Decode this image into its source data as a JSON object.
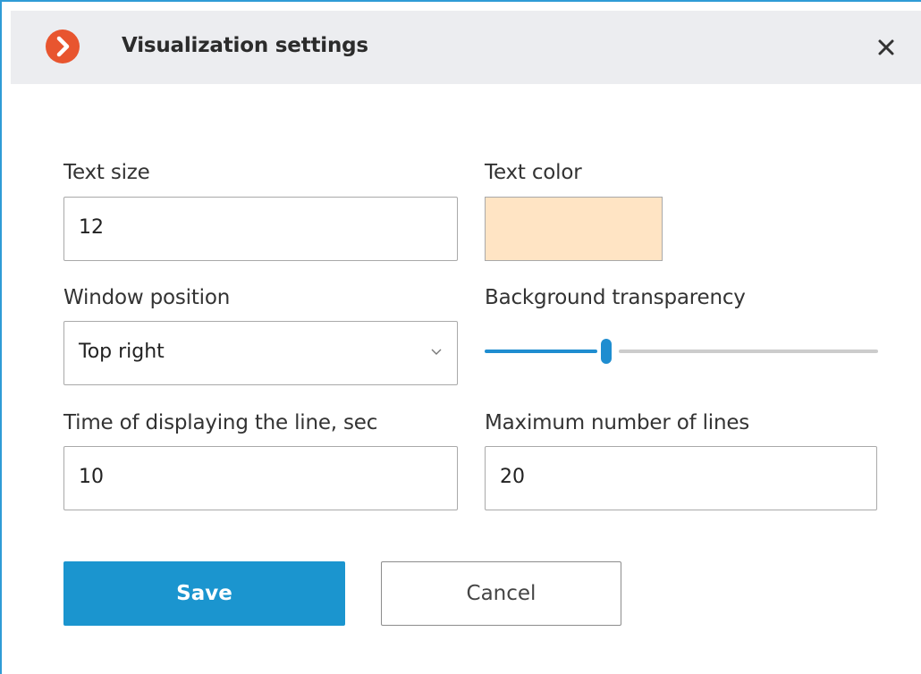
{
  "dialog": {
    "title": "Visualization settings",
    "app_icon": "chevron-right-circle-icon",
    "close_icon": "close-icon"
  },
  "fields": {
    "text_size": {
      "label": "Text size",
      "value": "12"
    },
    "text_color": {
      "label": "Text color",
      "color": "#ffe4c4"
    },
    "window_position": {
      "label": "Window position",
      "selected": "Top right"
    },
    "background_transparency": {
      "label": "Background transparency",
      "value_fraction": 0.31
    },
    "display_time": {
      "label": "Time of displaying the line, sec",
      "value": "10"
    },
    "max_lines": {
      "label": "Maximum number of lines",
      "value": "20"
    }
  },
  "buttons": {
    "save": "Save",
    "cancel": "Cancel"
  },
  "colors": {
    "accent": "#1b95cf",
    "app_icon": "#e8552f",
    "title_bar": "#ecedf0"
  }
}
